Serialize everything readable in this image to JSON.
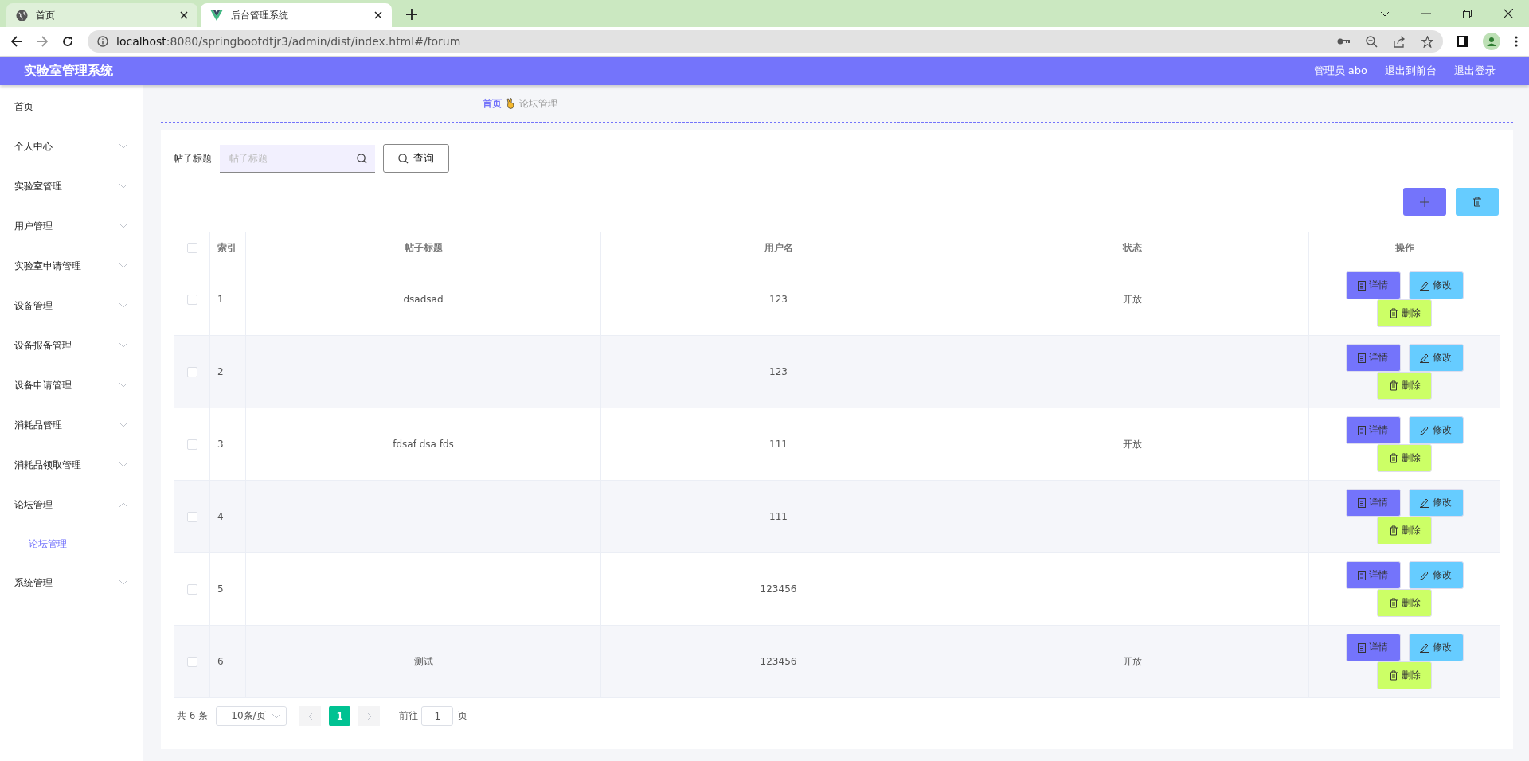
{
  "browser": {
    "tabs": [
      {
        "title": "首页",
        "kind": "globe",
        "selected": false
      },
      {
        "title": "后台管理系统",
        "kind": "vue",
        "selected": true
      }
    ],
    "address": {
      "host": "localhost",
      "rest": ":8080/springbootdtjr3/admin/dist/index.html#/forum"
    }
  },
  "header": {
    "title": "实验室管理系统",
    "links": [
      "管理员 abo",
      "退出到前台",
      "退出登录"
    ]
  },
  "sidebar": {
    "items": [
      {
        "label": "首页",
        "kind": "link"
      },
      {
        "label": "个人中心",
        "kind": "menu",
        "expanded": false
      },
      {
        "label": "实验室管理",
        "kind": "menu",
        "expanded": false
      },
      {
        "label": "用户管理",
        "kind": "menu",
        "expanded": false
      },
      {
        "label": "实验室申请管理",
        "kind": "menu",
        "expanded": false
      },
      {
        "label": "设备管理",
        "kind": "menu",
        "expanded": false
      },
      {
        "label": "设备报备管理",
        "kind": "menu",
        "expanded": false
      },
      {
        "label": "设备申请管理",
        "kind": "menu",
        "expanded": false
      },
      {
        "label": "消耗品管理",
        "kind": "menu",
        "expanded": false
      },
      {
        "label": "消耗品领取管理",
        "kind": "menu",
        "expanded": false
      },
      {
        "label": "论坛管理",
        "kind": "menu",
        "expanded": true,
        "children": [
          {
            "label": "论坛管理",
            "selected": true
          }
        ]
      },
      {
        "label": "系统管理",
        "kind": "menu",
        "expanded": false
      }
    ]
  },
  "breadcrumb": [
    "首页",
    "论坛管理"
  ],
  "search": {
    "label": "帖子标题",
    "placeholder": "帖子标题",
    "button": "查询"
  },
  "table": {
    "header_checked": false,
    "columns": [
      "索引",
      "帖子标题",
      "用户名",
      "状态",
      "操作"
    ],
    "rows": [
      {
        "checked": false,
        "index": "1",
        "title": "dsadsad",
        "user": "123",
        "status": "开放",
        "actions": [
          "详情",
          "修改",
          "删除"
        ]
      },
      {
        "checked": false,
        "index": "2",
        "user": "123",
        "actions": [
          "详情",
          "修改",
          "删除"
        ]
      },
      {
        "checked": false,
        "index": "3",
        "title": "fdsaf dsa fds",
        "user": "111",
        "status": "开放",
        "actions": [
          "详情",
          "修改",
          "删除"
        ]
      },
      {
        "checked": false,
        "index": "4",
        "user": "111",
        "actions": [
          "详情",
          "修改",
          "删除"
        ]
      },
      {
        "checked": false,
        "index": "5",
        "user": "123456",
        "actions": [
          "详情",
          "修改",
          "删除"
        ]
      },
      {
        "checked": false,
        "index": "6",
        "title": "测试",
        "user": "123456",
        "status": "开放",
        "actions": [
          "详情",
          "修改",
          "删除"
        ]
      }
    ]
  },
  "pagination": {
    "total": "共 6 条",
    "page_size": "10条/页",
    "pages": [
      {
        "label": "1",
        "selected": true
      }
    ],
    "jump_label": "前往",
    "jump_value": "1",
    "suffix": "页"
  }
}
